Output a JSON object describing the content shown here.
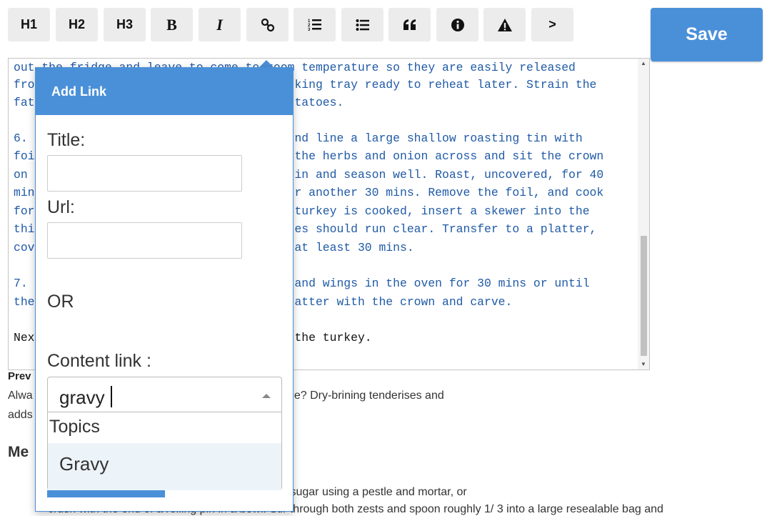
{
  "toolbar": {
    "h1": "H1",
    "h2": "H2",
    "h3": "H3",
    "bold": "B",
    "italic": "I",
    "more": ">",
    "icons": [
      "link-icon",
      "ordered-list-icon",
      "unordered-list-icon",
      "quote-icon",
      "info-icon",
      "warning-icon"
    ]
  },
  "save_label": "Save",
  "editor": {
    "lines": [
      "out the fridge and leave to come to room temperature so they are easily released",
      "from                                    king tray ready to reheat later. Strain the",
      "fat                                     tatoes.",
      "",
      "6.                                      nd line a large shallow roasting tin with",
      "foi                                     the herbs and onion across and sit the crown",
      "on                                      in and season well. Roast, uncovered, for 40",
      "min                                     r another 30 mins. Remove the foil, and cook",
      "for                                     turkey is cooked, insert a skewer into the",
      "thi                                     es should run clear. Transfer to a platter,",
      "cov                                     at least 30 mins.",
      "",
      "7.                                      and wings in the oven for 30 mins or until",
      "the                                     atter with the crown and carve.",
      "",
      "Nex                                     the turkey."
    ]
  },
  "preview": {
    "title": "Prev",
    "line1": "Alwa                                          reast succulent, and the leg meat falling off the bone? Dry-brining tenderises and",
    "line2": "adds"
  },
  "method_heading": "Me",
  "step": {
    "line1": "combining the salt, peppercorns, bay, sage and sugar using a pestle and mortar, or",
    "line2": "crush with the end of a rolling pin in a bowl. Stir through both zests and spoon roughly 1/ 3 into a large resealable bag and"
  },
  "modal": {
    "title": "Add Link",
    "title_label": "Title:",
    "url_label": "Url:",
    "or_label": "OR",
    "content_link_label": "Content link :",
    "content_link_value": "gravy",
    "dropdown_group": "Topics",
    "dropdown_option": "Gravy"
  },
  "colors": {
    "accent": "#4a90d9",
    "editor_text": "#1f5aa6",
    "option_highlight": "#edf4f9"
  }
}
